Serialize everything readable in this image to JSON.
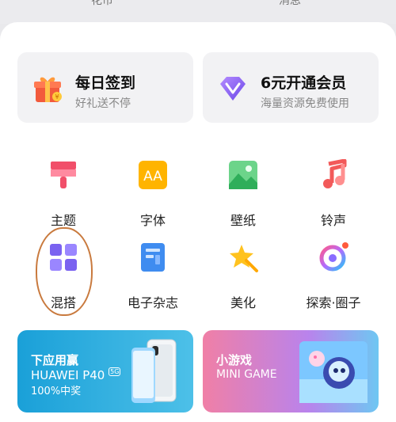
{
  "top": {
    "left_label": "花币",
    "right_label": "消息"
  },
  "cards": [
    {
      "title": "每日签到",
      "subtitle": "好礼送不停",
      "icon": "gift-icon"
    },
    {
      "title": "6元开通会员",
      "subtitle": "海量资源免费使用",
      "icon": "diamond-icon"
    }
  ],
  "grid": [
    {
      "label": "主题",
      "icon": "brush-icon"
    },
    {
      "label": "字体",
      "icon": "font-icon"
    },
    {
      "label": "壁纸",
      "icon": "wallpaper-icon"
    },
    {
      "label": "铃声",
      "icon": "music-note-icon"
    },
    {
      "label": "混搭",
      "icon": "grid-mix-icon"
    },
    {
      "label": "电子杂志",
      "icon": "magazine-icon"
    },
    {
      "label": "美化",
      "icon": "star-wand-icon"
    },
    {
      "label": "探索·圈子",
      "icon": "ring-icon"
    }
  ],
  "banners": [
    {
      "line1": "下应用赢",
      "line2": "HUAWEI P40",
      "line3": "100%中奖",
      "badge": "5G"
    },
    {
      "line1": "小游戏",
      "line2": "MINI GAME"
    }
  ],
  "colors": {
    "accent_orange": "#c97a3e",
    "banner_blue": "#1da3d9",
    "banner_pink": "#e57fc0"
  }
}
